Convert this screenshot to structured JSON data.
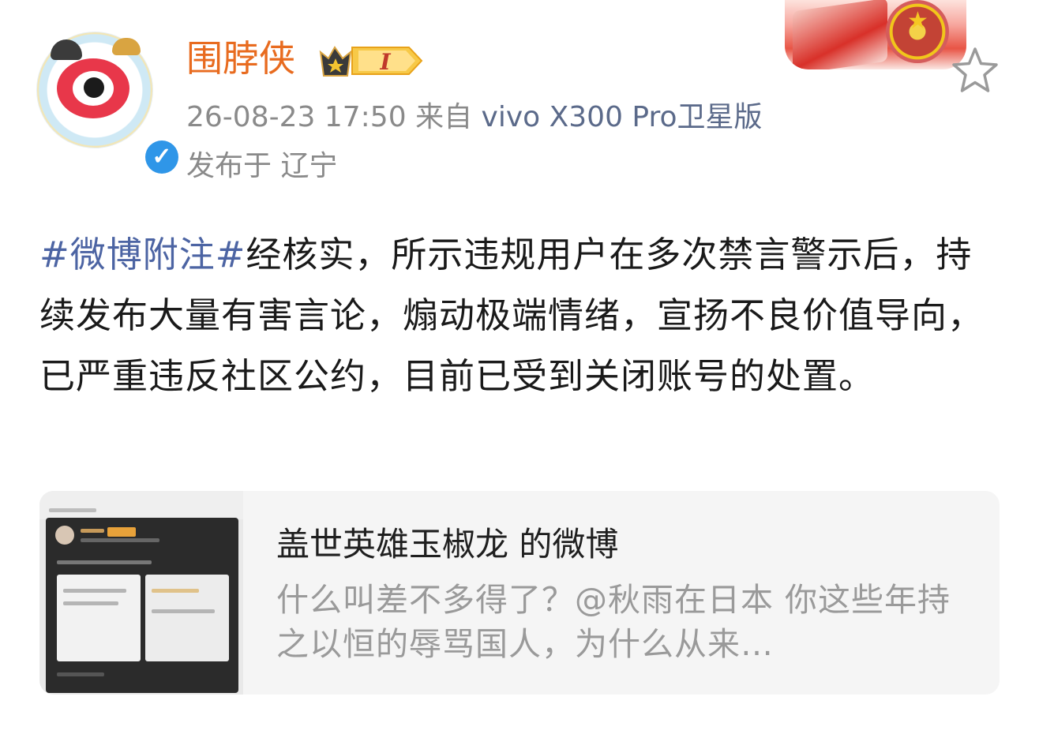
{
  "post": {
    "author": {
      "name": "围脖侠",
      "level_badge": "I"
    },
    "meta": {
      "timestamp": "26-08-23 17:50",
      "source_prefix": "来自",
      "device": "vivo X300 Pro卫星版",
      "location": "发布于 辽宁"
    },
    "content": {
      "topic": "#微博附注#",
      "text": "经核实，所示违规用户在多次禁言警示后，持续发布大量有害言论，煽动极端情绪，宣扬不良价值导向，已严重违反社区公约，目前已受到关闭账号的处置。"
    },
    "quoted": {
      "title": "盖世英雄玉椒龙 的微博",
      "excerpt": "什么叫差不多得了？@秋雨在日本  你这些年持之以恒的辱骂国人，为什么从来…"
    }
  },
  "icons": {
    "favorite": "star-outline-icon",
    "verified": "verified-v-icon",
    "vip": "crown-badge-icon"
  },
  "colors": {
    "username": "#e86b1f",
    "topic": "#4c64a3",
    "meta": "#8a8a8a",
    "verified": "#2f96e8",
    "card_bg": "#f5f5f5"
  }
}
